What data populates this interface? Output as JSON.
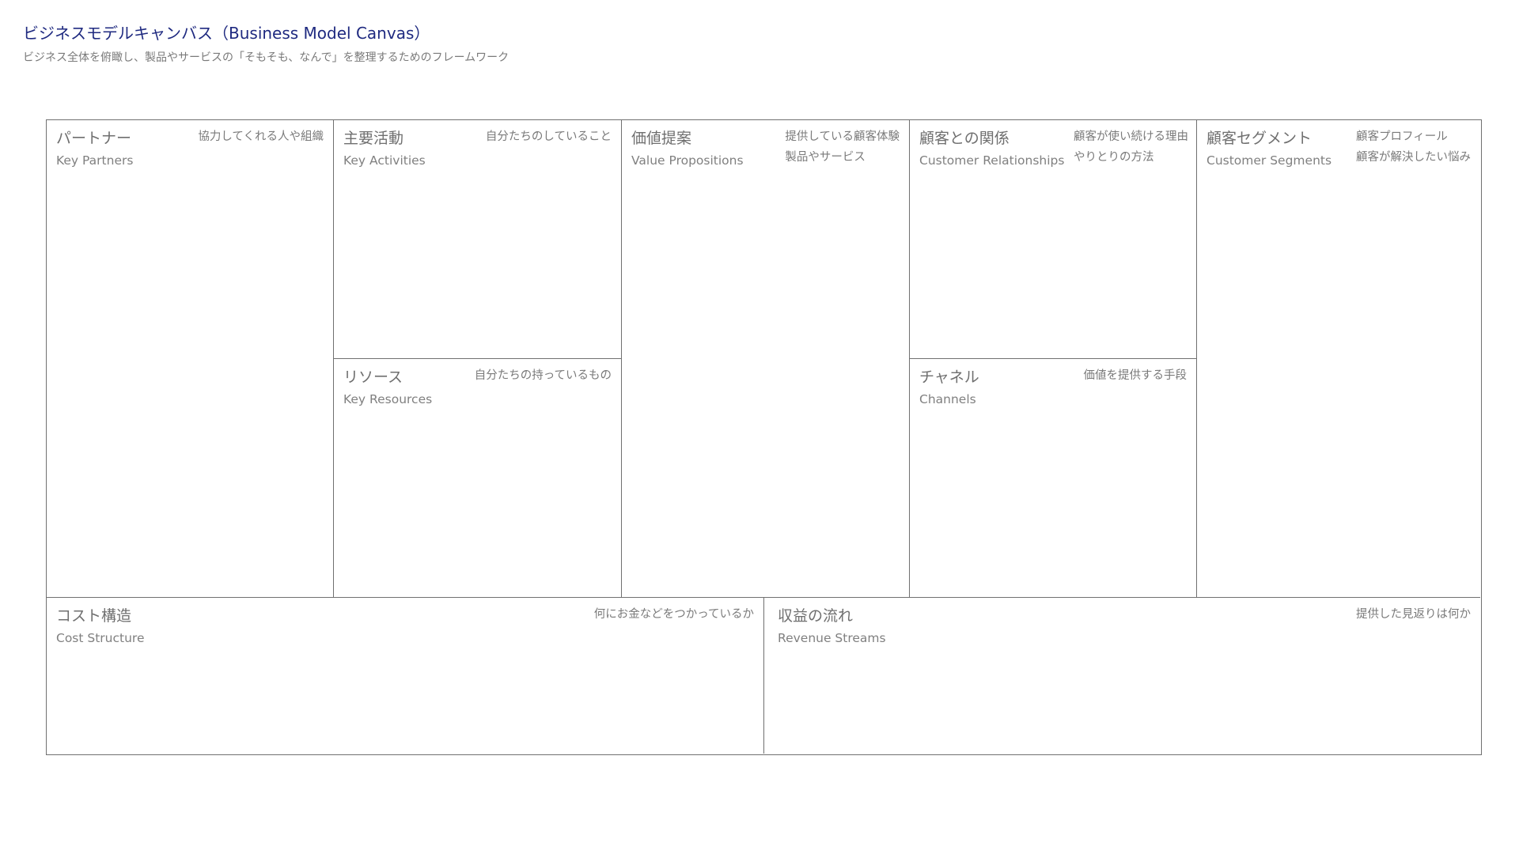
{
  "header": {
    "title": "ビジネスモデルキャンバス（Business Model Canvas）",
    "subtitle": "ビジネス全体を俯瞰し、製品やサービスの「そもそも、なんで」を整理するためのフレームワーク"
  },
  "canvas": {
    "key_partners": {
      "title_jp": "パートナー",
      "title_en": "Key Partners",
      "hints": [
        "協力してくれる人や組織"
      ]
    },
    "key_activities": {
      "title_jp": "主要活動",
      "title_en": "Key Activities",
      "hints": [
        "自分たちのしていること"
      ]
    },
    "key_resources": {
      "title_jp": "リソース",
      "title_en": "Key Resources",
      "hints": [
        "自分たちの持っているもの"
      ]
    },
    "value_propositions": {
      "title_jp": "価値提案",
      "title_en": "Value Propositions",
      "hints": [
        "提供している顧客体験",
        "製品やサービス"
      ]
    },
    "customer_relationships": {
      "title_jp": "顧客との関係",
      "title_en": "Customer Relationships",
      "hints": [
        "顧客が使い続ける理由",
        "やりとりの方法"
      ]
    },
    "channels": {
      "title_jp": "チャネル",
      "title_en": "Channels",
      "hints": [
        "価値を提供する手段"
      ]
    },
    "customer_segments": {
      "title_jp": "顧客セグメント",
      "title_en": "Customer Segments",
      "hints": [
        "顧客プロフィール",
        "顧客が解決したい悩み"
      ]
    },
    "cost_structure": {
      "title_jp": "コスト構造",
      "title_en": "Cost Structure",
      "hints": [
        "何にお金などをつかっているか"
      ]
    },
    "revenue_streams": {
      "title_jp": "収益の流れ",
      "title_en": "Revenue Streams",
      "hints": [
        "提供した見返りは何か"
      ]
    }
  }
}
